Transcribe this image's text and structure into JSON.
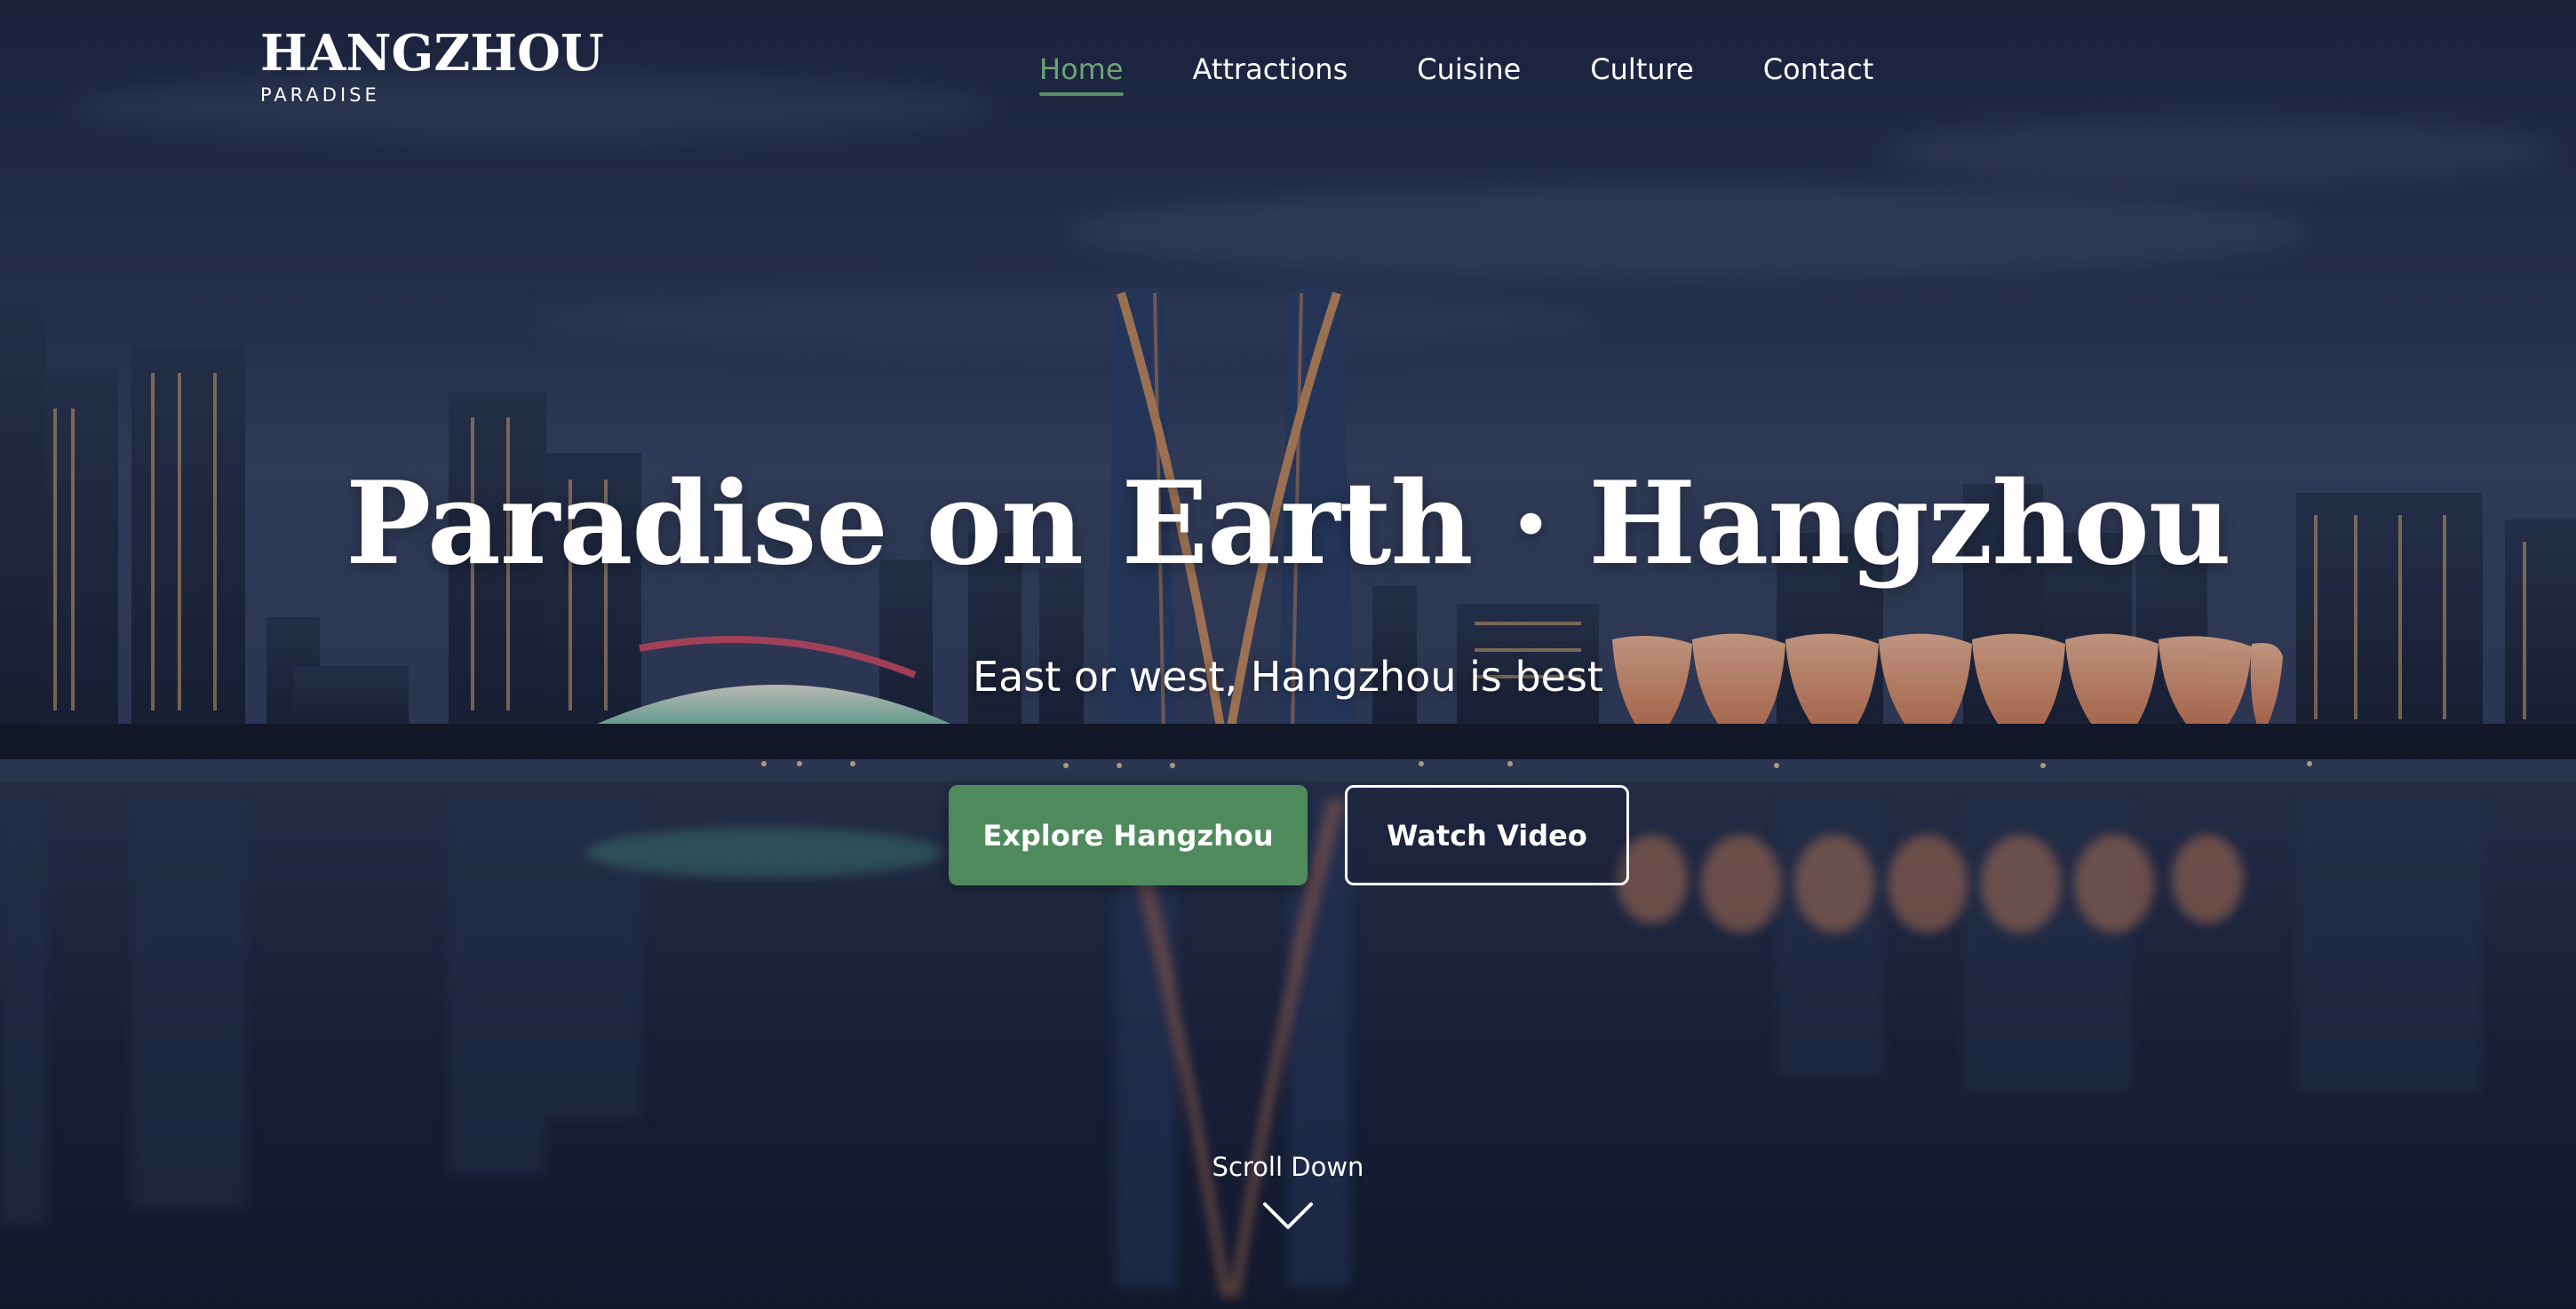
{
  "brand": {
    "name": "HANGZHOU",
    "tagline": "PARADISE"
  },
  "nav": {
    "items": [
      {
        "label": "Home",
        "active": true
      },
      {
        "label": "Attractions",
        "active": false
      },
      {
        "label": "Cuisine",
        "active": false
      },
      {
        "label": "Culture",
        "active": false
      },
      {
        "label": "Contact",
        "active": false
      }
    ]
  },
  "hero": {
    "title": "Paradise on Earth · Hangzhou",
    "subtitle": "East or west, Hangzhou is best",
    "primary_button": "Explore Hangzhou",
    "secondary_button": "Watch Video",
    "scroll_label": "Scroll Down",
    "scroll_icon": "chevron-down-icon"
  },
  "colors": {
    "accent": "#4f8a5c",
    "nav_active": "#6aa478",
    "text": "#ffffff",
    "background": "#202846"
  }
}
